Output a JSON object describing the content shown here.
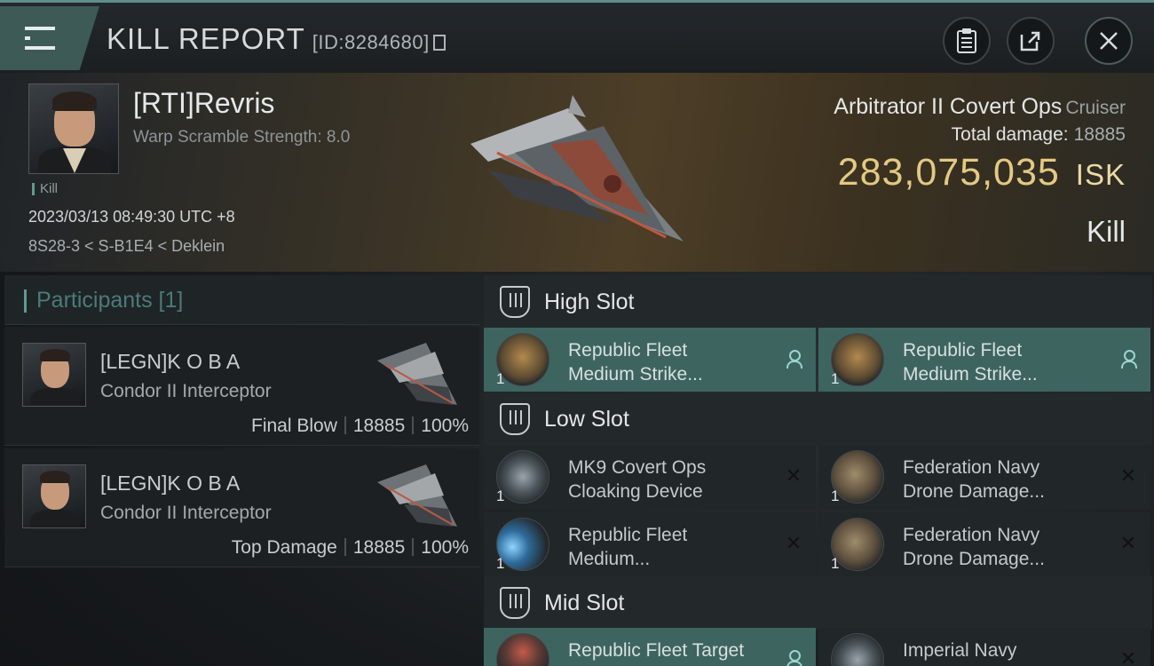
{
  "header": {
    "title": "KILL REPORT",
    "report_id": "[ID:8284680]"
  },
  "victim": {
    "name": "[RTI]Revris",
    "warp_scramble": "Warp Scramble Strength: 8.0",
    "tag": "Kill",
    "datetime": "2023/03/13 08:49:30 UTC +8",
    "location": "8S28-3 < S-B1E4 < Deklein",
    "ship_name": "Arbitrator II Covert Ops",
    "ship_class": "Cruiser",
    "total_damage_label": "Total damage:",
    "total_damage": "18885",
    "isk_value": "283,075,035",
    "isk_unit": "ISK",
    "result": "Kill"
  },
  "participants": {
    "title": "Participants [1]",
    "rows": [
      {
        "name": "[LEGN]K O B A",
        "ship": "Condor II Interceptor",
        "role": "Final Blow",
        "damage": "18885",
        "percent": "100%"
      },
      {
        "name": "[LEGN]K O B A",
        "ship": "Condor II Interceptor",
        "role": "Top Damage",
        "damage": "18885",
        "percent": "100%"
      }
    ]
  },
  "fitting": {
    "high_slot_label": "High Slot",
    "low_slot_label": "Low Slot",
    "mid_slot_label": "Mid Slot",
    "high": [
      {
        "line1": "Republic Fleet",
        "line2": "Medium Strike...",
        "qty": "1"
      },
      {
        "line1": "Republic Fleet",
        "line2": "Medium Strike...",
        "qty": "1"
      }
    ],
    "low": [
      {
        "line1": "MK9 Covert Ops",
        "line2": "Cloaking Device",
        "qty": "1"
      },
      {
        "line1": "Federation Navy",
        "line2": "Drone Damage...",
        "qty": "1"
      },
      {
        "line1": "Republic Fleet",
        "line2": "Medium...",
        "qty": "1"
      },
      {
        "line1": "Federation Navy",
        "line2": "Drone Damage...",
        "qty": "1"
      }
    ],
    "mid": [
      {
        "line1": "Republic Fleet Target",
        "line2": "",
        "qty": ""
      },
      {
        "line1": "Imperial Navy",
        "line2": "",
        "qty": ""
      }
    ]
  },
  "colors": {
    "accent": "#5f9a90",
    "dropped_module_bg": "#3e6460",
    "isk_gold": "#e3c983"
  }
}
